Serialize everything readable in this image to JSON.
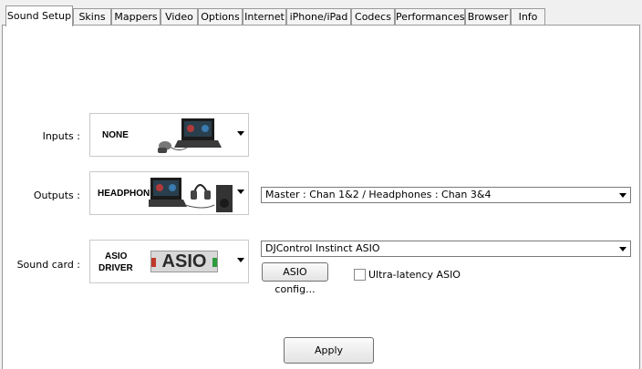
{
  "tabs": [
    {
      "label": "Sound Setup"
    },
    {
      "label": "Skins"
    },
    {
      "label": "Mappers"
    },
    {
      "label": "Video"
    },
    {
      "label": "Options"
    },
    {
      "label": "Internet"
    },
    {
      "label": "iPhone/iPad"
    },
    {
      "label": "Codecs"
    },
    {
      "label": "Performances"
    },
    {
      "label": "Browser"
    },
    {
      "label": "Info"
    }
  ],
  "inputs": {
    "label": "Inputs :",
    "value": "NONE"
  },
  "outputs": {
    "label": "Outputs :",
    "value": "HEADPHONES",
    "routing": "Master : Chan 1&2 / Headphones : Chan 3&4"
  },
  "sound_card": {
    "label": "Sound card :",
    "value_line1": "ASIO",
    "value_line2": "DRIVER",
    "logo_text": "ASIO",
    "device": "DJControl Instinct ASIO",
    "config_button": "ASIO config...",
    "ultra_latency": {
      "label": "Ultra-latency ASIO",
      "checked": false
    }
  },
  "apply_button": "Apply"
}
